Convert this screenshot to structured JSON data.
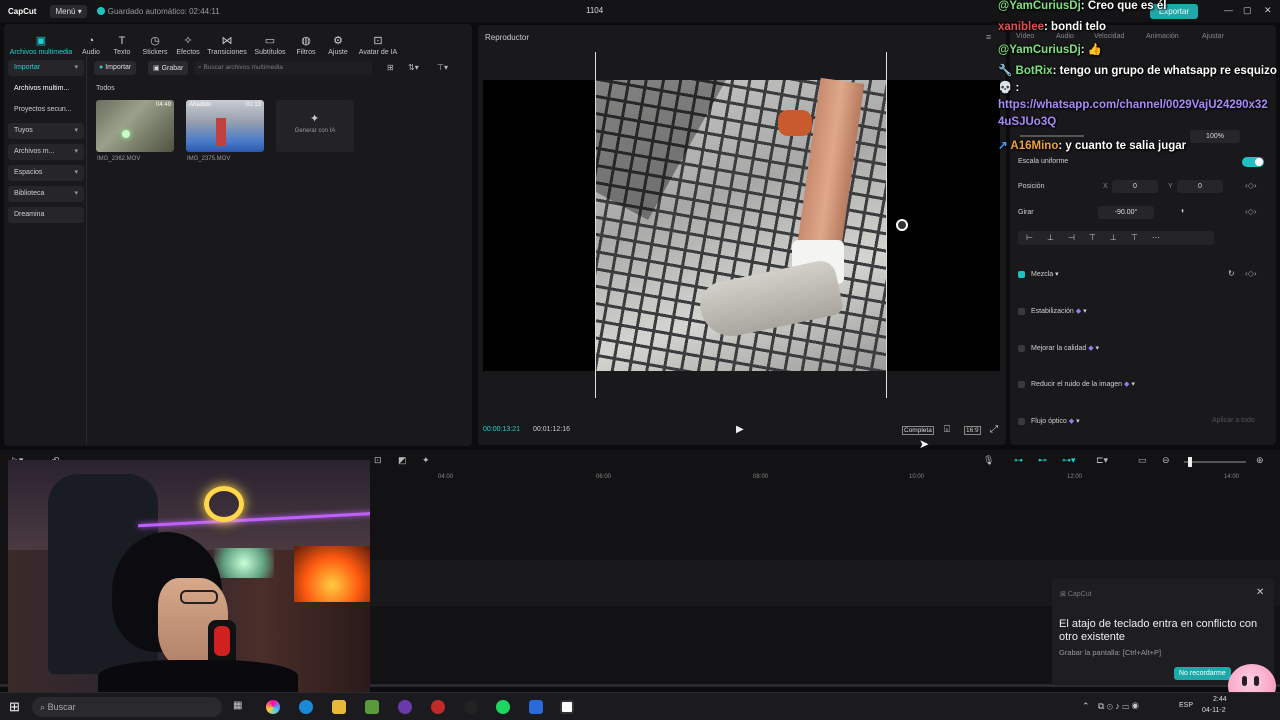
{
  "topbar": {
    "app_name": "CapCut",
    "menu_label": "Menú",
    "autosave": "Guardado automático: 02:44:11",
    "project_name": "1104"
  },
  "media_tabs": [
    {
      "label": "Archivos multimedia",
      "icon": "media-icon"
    },
    {
      "label": "Audio",
      "icon": "audio-icon"
    },
    {
      "label": "Texto",
      "icon": "text-icon"
    },
    {
      "label": "Stickers",
      "icon": "sticker-icon"
    },
    {
      "label": "Efectos",
      "icon": "effects-icon"
    },
    {
      "label": "Transiciones",
      "icon": "transition-icon"
    },
    {
      "label": "Subtítulos",
      "icon": "subtitle-icon"
    },
    {
      "label": "Filtros",
      "icon": "filter-icon"
    },
    {
      "label": "Ajuste",
      "icon": "adjust-icon"
    },
    {
      "label": "Avatar de IA",
      "icon": "avatar-icon"
    }
  ],
  "sidebar": {
    "items": [
      {
        "label": "Importar"
      },
      {
        "label": "Archivos multim..."
      },
      {
        "label": "Proyectos secun..."
      },
      {
        "label": "Tuyos"
      },
      {
        "label": "Archivos m..."
      },
      {
        "label": "Espacios"
      },
      {
        "label": "Biblioteca"
      },
      {
        "label": "Dreamina"
      }
    ]
  },
  "media": {
    "import_label": "Importar",
    "record_label": "Grabar",
    "search_placeholder": "Buscar archivos multimedia",
    "section": "Todos",
    "files": [
      {
        "name": "IMG_2362.MOV",
        "duration": "04:49",
        "tag": ""
      },
      {
        "name": "IMG_2375.MOV",
        "duration": "01:13",
        "tag": "Añadido"
      }
    ],
    "generate_label": "Generar con IA"
  },
  "player": {
    "title": "Reproductor",
    "current_time": "00:00:13:21",
    "total_time": "00:01:12:16",
    "quality_label": "Completa",
    "ratio_label": "16:9"
  },
  "properties": {
    "tabs": [
      "Vídeo",
      "Audio",
      "Velocidad",
      "Animación",
      "Ajustar"
    ],
    "scale_value": "100%",
    "uniform_scale": "Escala uniforme",
    "position_label": "Posición",
    "pos_x_label": "X",
    "pos_x": "0",
    "pos_y_label": "Y",
    "pos_y": "0",
    "rotate_label": "Girar",
    "rotate_value": "-90.00°",
    "blend_label": "Mezcla",
    "stabilization_label": "Estabilización",
    "enhance_label": "Mejorar la calidad",
    "denoise_label": "Reducir el ruido de la imagen",
    "optical_flow_label": "Flujo óptico",
    "apply_all_label": "Aplicar a todo",
    "export_label": "Exportar"
  },
  "chat": [
    {
      "user": "@YamCuriusDj",
      "text": ": Creo que es él",
      "color": "#7fe07f"
    },
    {
      "user": "xaniblee",
      "text": ": bondi telo",
      "color": "#e05050"
    },
    {
      "user": "@YamCuriusDj",
      "text": ": 👍",
      "color": "#7fe07f"
    },
    {
      "user": "BotRix",
      "text": ": tengo un grupo de whatsapp re esquizo",
      "color": "#7fe07f"
    },
    {
      "user": "💀",
      "text": ":",
      "color": "#ffffff"
    },
    {
      "user": "",
      "text": "https://whatsapp.com/channel/0029VajU24290x32",
      "color": "#a78bfa"
    },
    {
      "user": "",
      "text": "4uSJUo3Q",
      "color": "#a78bfa"
    },
    {
      "user": "A16Mino",
      "text": ": y cuanto te salia jugar",
      "color": "#f0a040"
    }
  ],
  "timeline": {
    "ruler": [
      "04:00",
      "06:00",
      "08:00",
      "10:00",
      "12:00",
      "14:00"
    ]
  },
  "toast": {
    "app": "CapCut",
    "message": "El atajo de teclado entra en conflicto con otro existente",
    "detail": "Grabar la pantalla: [Ctrl+Alt+P]",
    "button": "No recordarme"
  },
  "taskbar": {
    "search_placeholder": "Buscar",
    "lang": "ESP",
    "time": "2:44",
    "date": "04-11-2"
  }
}
